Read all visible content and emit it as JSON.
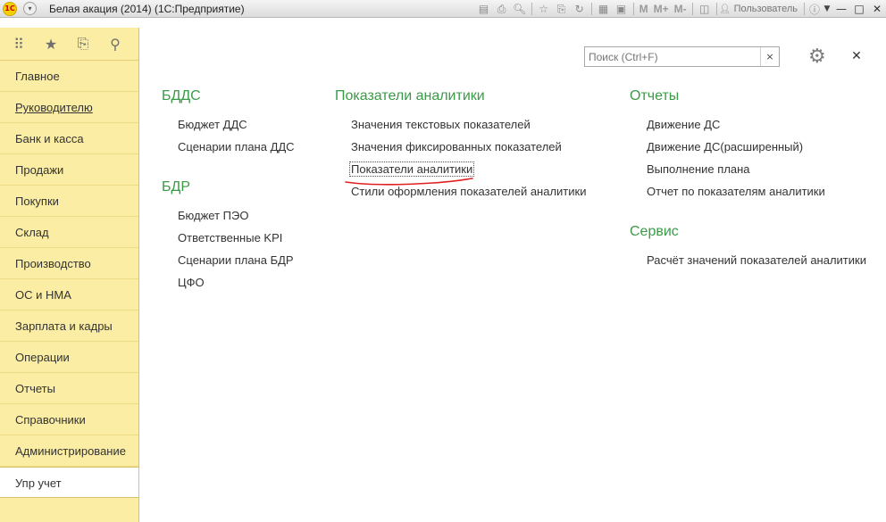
{
  "window": {
    "title": "Белая акация (2014)  (1С:Предприятие)",
    "logo_text": "1С",
    "user": "Пользователь"
  },
  "toolbar": {
    "mem_labels": [
      "M",
      "M+",
      "M-"
    ]
  },
  "sidebar": {
    "items": [
      {
        "label": "Главное"
      },
      {
        "label": "Руководителю"
      },
      {
        "label": "Банк и касса"
      },
      {
        "label": "Продажи"
      },
      {
        "label": "Покупки"
      },
      {
        "label": "Склад"
      },
      {
        "label": "Производство"
      },
      {
        "label": "ОС и НМА"
      },
      {
        "label": "Зарплата и кадры"
      },
      {
        "label": "Операции"
      },
      {
        "label": "Отчеты"
      },
      {
        "label": "Справочники"
      },
      {
        "label": "Администрирование"
      },
      {
        "label": "Упр учет"
      }
    ]
  },
  "search": {
    "placeholder": "Поиск (Ctrl+F)",
    "clear_label": "×"
  },
  "sections": {
    "bdds": {
      "title": "БДДС",
      "links": [
        "Бюджет ДДС",
        "Сценарии плана ДДС"
      ]
    },
    "bdr": {
      "title": "БДР",
      "links": [
        "Бюджет ПЭО",
        "Ответственные KPI",
        "Сценарии плана БДР",
        "ЦФО"
      ]
    },
    "analytics": {
      "title": "Показатели аналитики",
      "links": [
        "Значения текстовых показателей",
        "Значения фиксированных показателей",
        "Показатели аналитики",
        "Стили оформления показателей аналитики"
      ]
    },
    "reports": {
      "title": "Отчеты",
      "links": [
        "Движение ДС",
        "Движение ДС(расширенный)",
        "Выполнение плана",
        "Отчет по показателям аналитики"
      ]
    },
    "service": {
      "title": "Сервис",
      "links": [
        "Расчёт значений показателей аналитики"
      ]
    }
  },
  "colors": {
    "section_title": "#3a9b47",
    "sidebar_bg": "#fbeda3",
    "annotation": "#e02020"
  }
}
